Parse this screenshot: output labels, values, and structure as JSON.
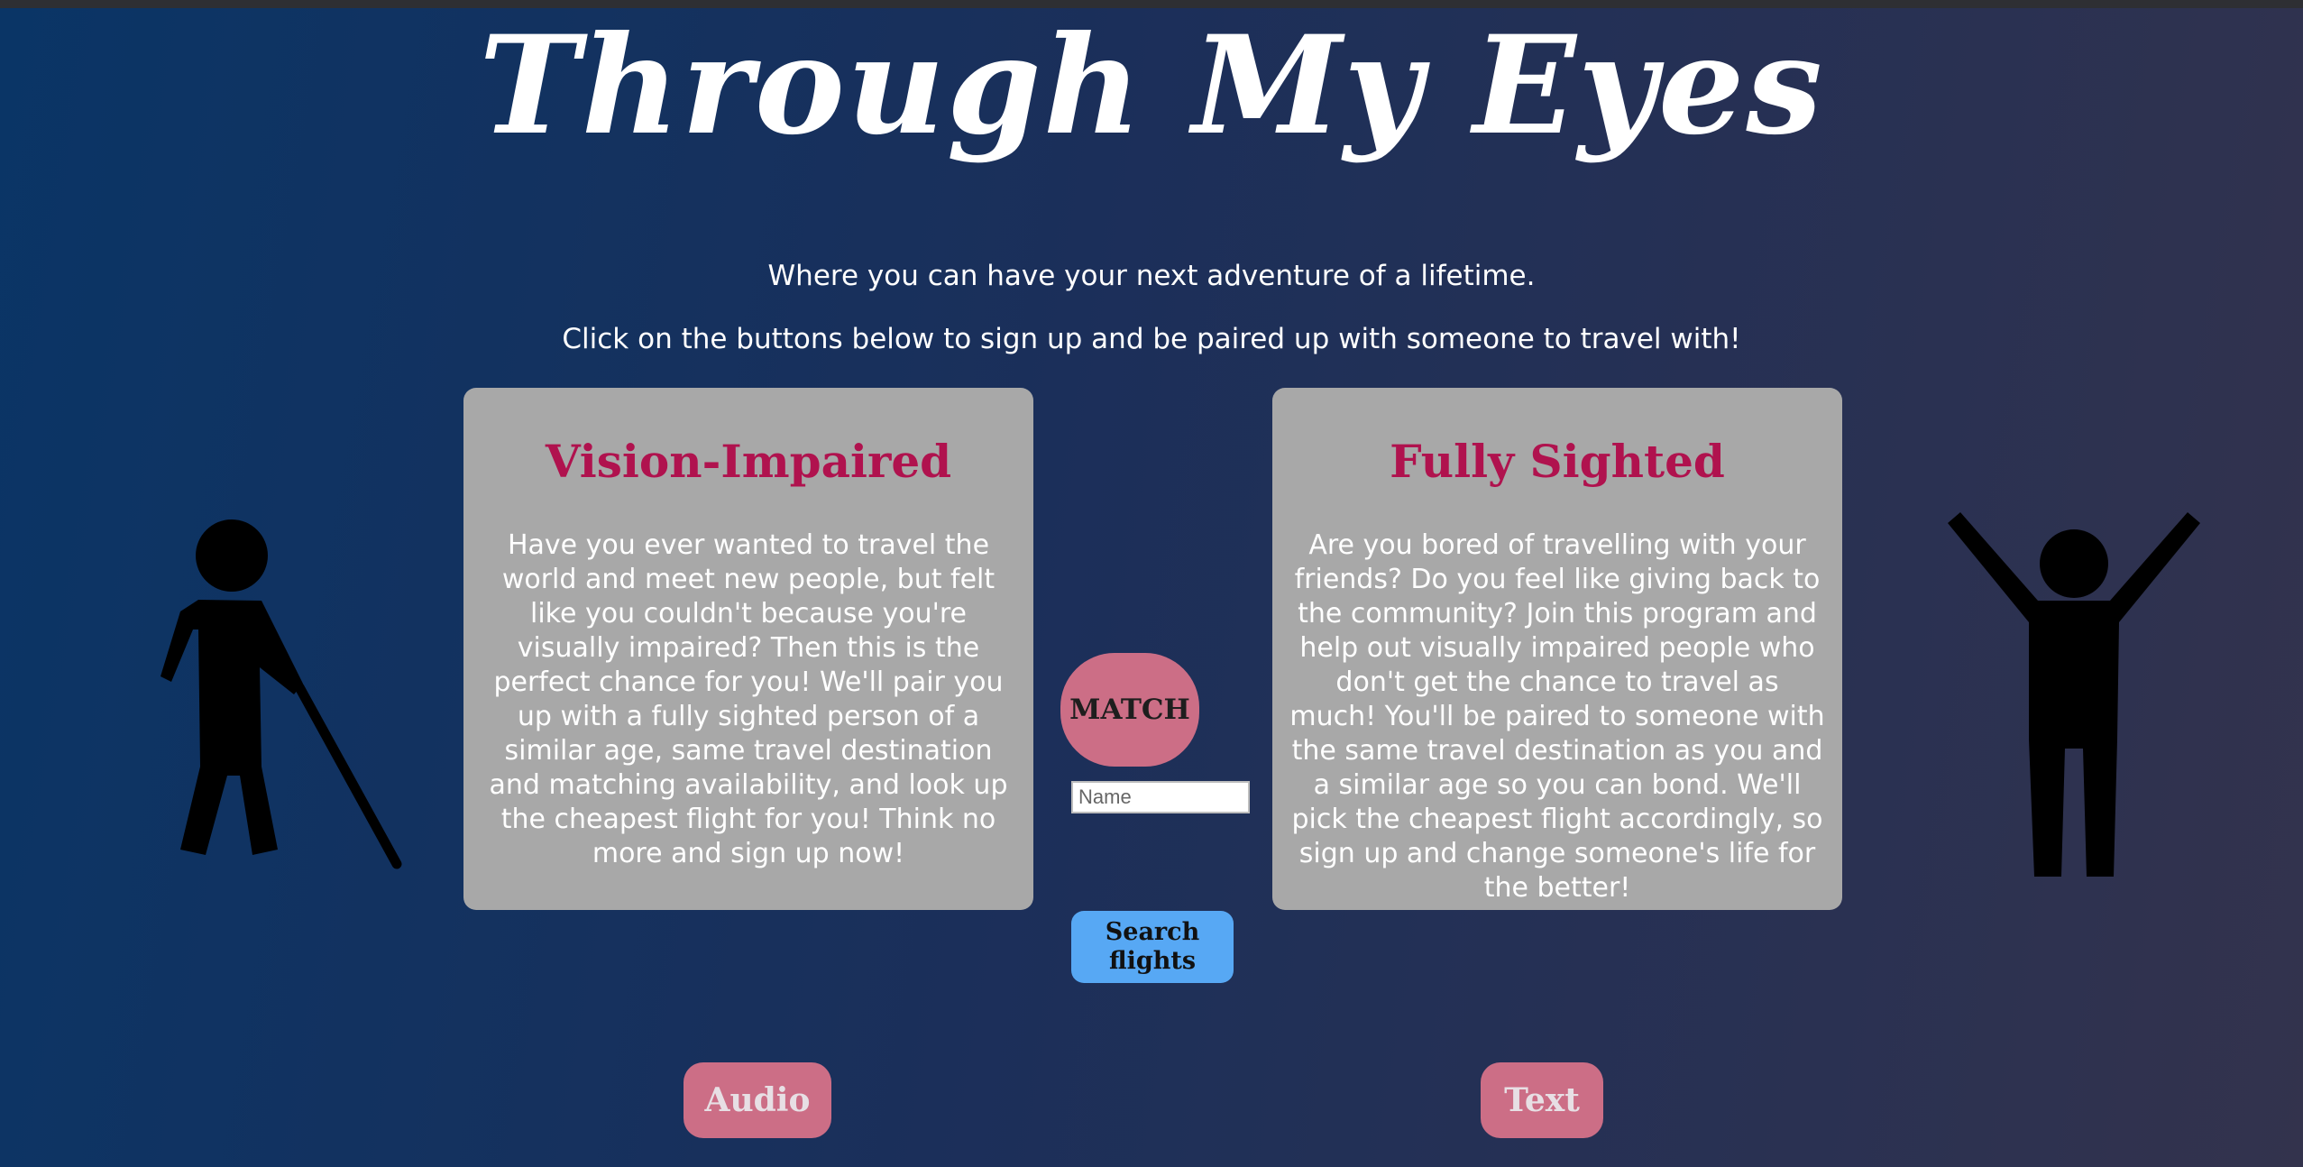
{
  "header": {
    "title": "Through My Eyes",
    "tagline_1": "Where you can have your next adventure of a lifetime.",
    "tagline_2": "Click on the buttons below to sign up and be paired up with someone to travel with!"
  },
  "cards": {
    "vision_impaired": {
      "heading": "Vision-Impaired",
      "body": "Have you ever wanted to travel the world and meet new people, but felt like you couldn't because you're visually impaired? Then this is the perfect chance for you! We'll pair you up with a fully sighted person of a similar age, same travel destination and matching availability, and look up the cheapest flight for you! Think no more and sign up now!"
    },
    "fully_sighted": {
      "heading": "Fully Sighted",
      "body": "Are you bored of travelling with your friends? Do you feel like giving back to the community? Join this program and help out visually impaired people who don't get the chance to travel as much! You'll be paired to someone with the same travel destination as you and a similar age so you can bond. We'll pick the cheapest flight accordingly, so sign up and change someone's life for the better!"
    }
  },
  "controls": {
    "match_label": "MATCH",
    "name_placeholder": "Name",
    "name_value": "",
    "search_label": "Search flights",
    "audio_label": "Audio",
    "text_label": "Text"
  },
  "icons": {
    "left_figure": "blind-person-with-cane-icon",
    "right_figure": "person-arms-raised-icon"
  },
  "colors": {
    "card_bg": "#a8a8a8",
    "heading": "#b0124e",
    "pink_button": "#cc6e86",
    "blue_button": "#57a8f4"
  }
}
